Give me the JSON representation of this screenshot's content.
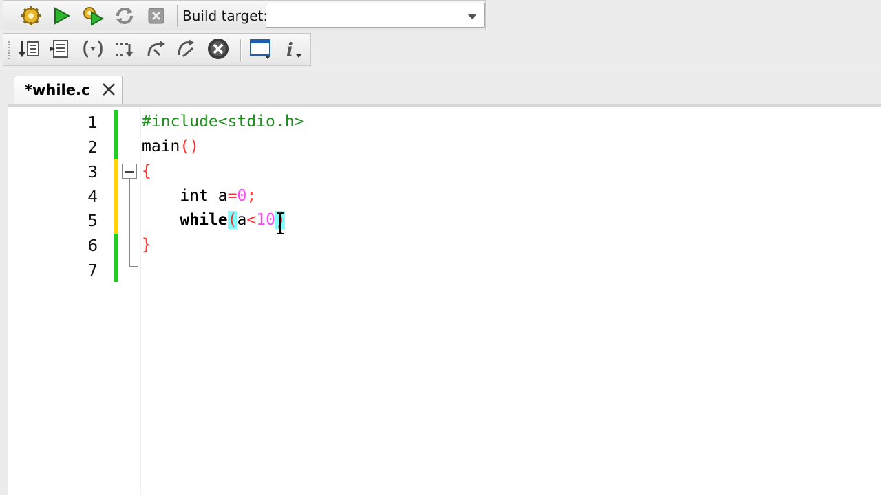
{
  "toolbar_build": {
    "buttons": [
      {
        "name": "build-icon"
      },
      {
        "name": "run-icon"
      },
      {
        "name": "build-and-run-icon"
      },
      {
        "name": "rebuild-icon"
      },
      {
        "name": "abort-icon"
      }
    ],
    "build_target_label": "Build target:",
    "build_target_value": ""
  },
  "toolbar_debug": {
    "buttons": [
      {
        "name": "debug-continue-icon"
      },
      {
        "name": "run-to-cursor-icon"
      },
      {
        "name": "next-line-icon"
      },
      {
        "name": "step-into-icon"
      },
      {
        "name": "step-out-icon"
      },
      {
        "name": "next-instruction-icon"
      },
      {
        "name": "stop-debugger-icon"
      },
      {
        "name": "debug-windows-icon"
      },
      {
        "name": "info-icon"
      }
    ]
  },
  "editor": {
    "tab_label": "*while.c",
    "line_numbers": [
      "1",
      "2",
      "3",
      "4",
      "5",
      "6",
      "7"
    ],
    "lines": {
      "l1": "#include<stdio.h>",
      "l2_name": "main",
      "l2_parens": "()",
      "l3": "{",
      "l4_kw": "int",
      "l4_var": " a",
      "l4_eq": "=",
      "l4_num": "0",
      "l4_semi": ";",
      "l5_kw": "while",
      "l5_open": "(",
      "l5_var": "a",
      "l5_lt": "<",
      "l5_num": "10",
      "l5_close": ")",
      "l6": "}"
    },
    "colors": {
      "preprocessor": "#1f8f1f",
      "operator": "#ff3030",
      "number": "#ff44ff",
      "brace_highlight": "#80ffff",
      "changed_saved": "#22cc22",
      "changed_unsaved": "#ffd400"
    }
  }
}
